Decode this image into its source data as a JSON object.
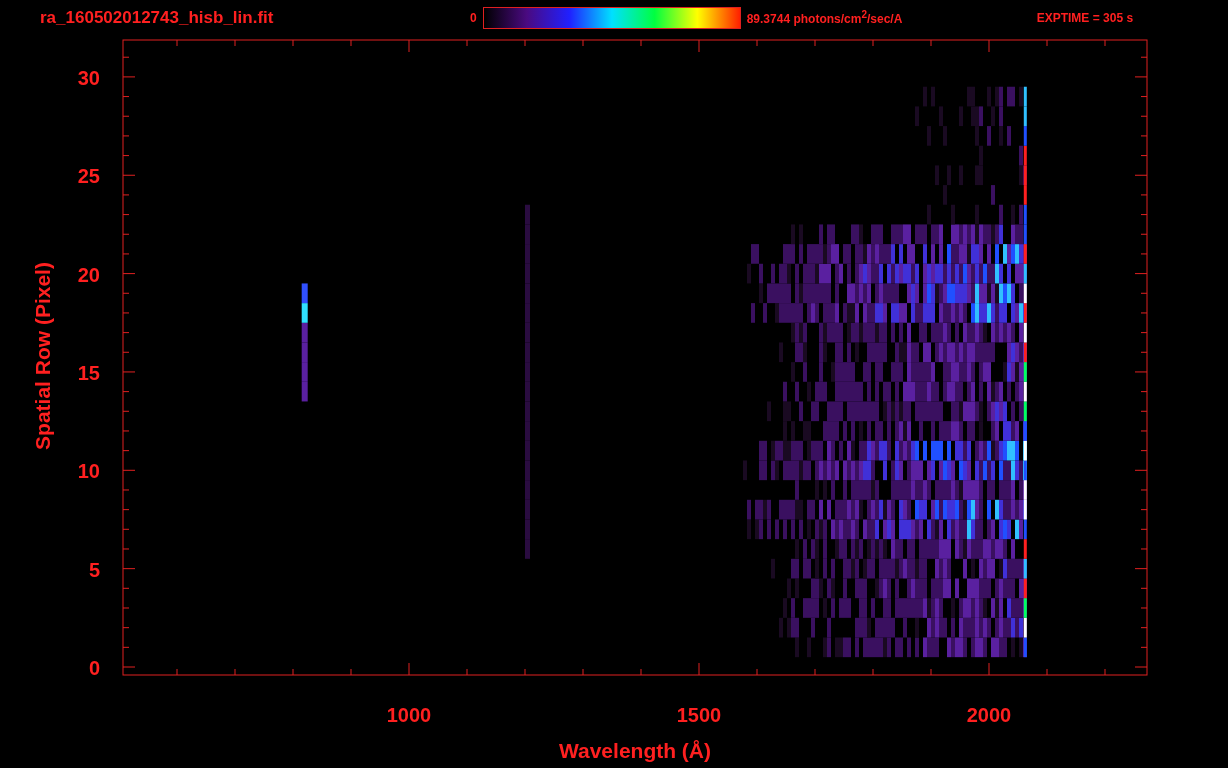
{
  "header": {
    "file_name": "ra_160502012743_hisb_lin.fit",
    "colorbar": {
      "min_label": "0",
      "max_label": "89.3744 photons/cm$^{2}$/sec/A"
    },
    "exposure": "EXPTIME = 305 s"
  },
  "plot": {
    "xlabel": "Wavelength (Å)",
    "ylabel": "Spatial Row (Pixel)",
    "xticks": [
      "1000",
      "1500",
      "2000"
    ],
    "yticks": [
      "30",
      "25",
      "20",
      "15",
      "10",
      "5",
      "0"
    ]
  }
}
